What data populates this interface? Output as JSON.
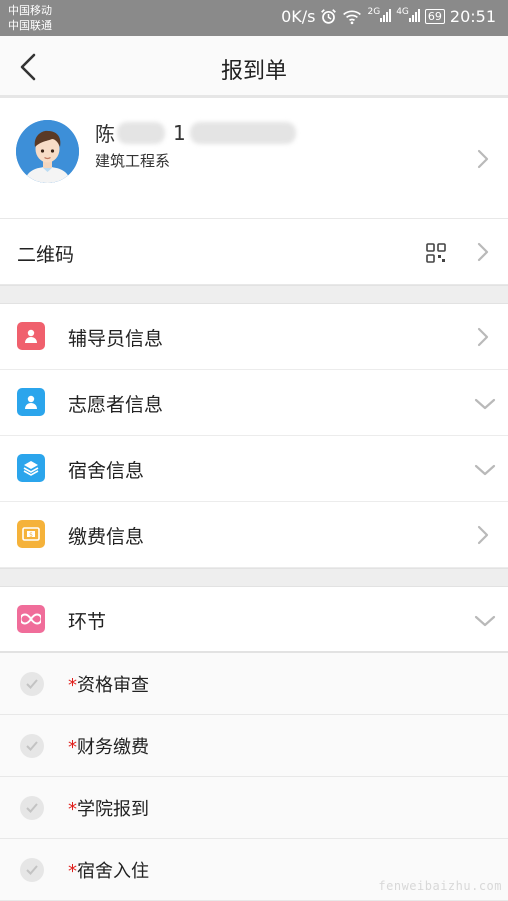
{
  "status_bar": {
    "carrier_1": "中国移动",
    "carrier_2": "中国联通",
    "net_speed": "0K/s",
    "battery": "69",
    "time": "20:51"
  },
  "header": {
    "title": "报到单"
  },
  "profile": {
    "name_visible": "陈",
    "id_visible": "1",
    "department": "建筑工程系"
  },
  "qr": {
    "label": "二维码"
  },
  "info_items": [
    {
      "label": "辅导员信息",
      "icon": "person-icon",
      "color": "#f0606d",
      "chevron": "right"
    },
    {
      "label": "志愿者信息",
      "icon": "person-icon",
      "color": "#2ba5ec",
      "chevron": "down"
    },
    {
      "label": "宿舍信息",
      "icon": "layers-icon",
      "color": "#2ba5ec",
      "chevron": "down"
    },
    {
      "label": "缴费信息",
      "icon": "payment-icon",
      "color": "#f5b23a",
      "chevron": "right"
    }
  ],
  "section": {
    "label": "环节",
    "icon": "infinity-icon",
    "color": "#f06d9a"
  },
  "steps": [
    {
      "star": "*",
      "label": "资格审查"
    },
    {
      "star": "*",
      "label": "财务缴费"
    },
    {
      "star": "*",
      "label": "学院报到"
    },
    {
      "star": "*",
      "label": "宿舍入住"
    }
  ],
  "watermark": "fenweibaizhu.com"
}
